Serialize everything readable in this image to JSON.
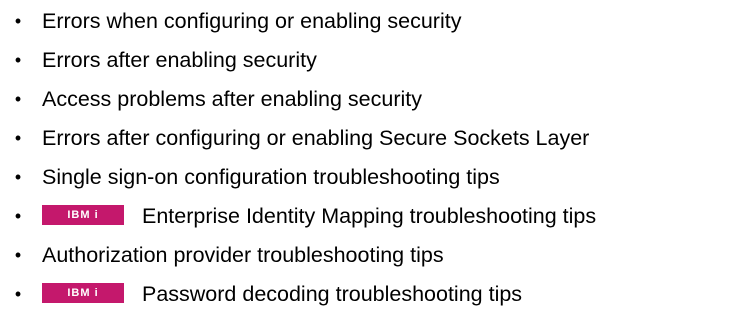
{
  "troubleshooting_topics": {
    "bullet_glyph": "•",
    "badge_color": "#c4186c",
    "items": [
      {
        "label": "Errors when configuring or enabling security",
        "platform_badge": ""
      },
      {
        "label": "Errors after enabling security",
        "platform_badge": ""
      },
      {
        "label": "Access problems after enabling security",
        "platform_badge": ""
      },
      {
        "label": "Errors after configuring or enabling Secure Sockets Layer",
        "platform_badge": ""
      },
      {
        "label": "Single sign-on configuration troubleshooting tips",
        "platform_badge": ""
      },
      {
        "label": "Enterprise Identity Mapping troubleshooting tips",
        "platform_badge": "IBM i"
      },
      {
        "label": "Authorization provider troubleshooting tips",
        "platform_badge": ""
      },
      {
        "label": "Password decoding troubleshooting tips",
        "platform_badge": "IBM i"
      }
    ]
  }
}
